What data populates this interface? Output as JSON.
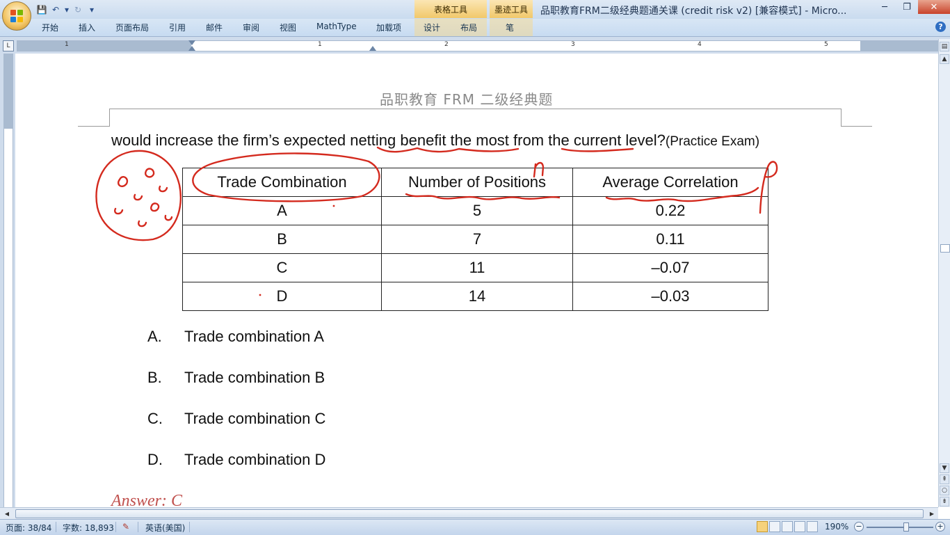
{
  "titlebar": {
    "window_title": "品职教育FRM二级经典题通关课 (credit risk v2) [兼容模式] - Micro...",
    "context_tab_table": "表格工具",
    "context_tab_ink": "墨迹工具",
    "minimize": "─",
    "restore": "❐",
    "close": "✕"
  },
  "qat": {
    "save_icon": "💾",
    "undo_icon": "↶",
    "undo_dropdown": "▾",
    "redo_icon": "↻",
    "customize_icon": "▾"
  },
  "ribbon": {
    "tabs": [
      "开始",
      "插入",
      "页面布局",
      "引用",
      "邮件",
      "审阅",
      "视图",
      "MathType",
      "加载项",
      "设计",
      "布局",
      "笔"
    ],
    "help": "?"
  },
  "ruler": {
    "corner": "L",
    "numbers": [
      "1",
      "1",
      "2",
      "3",
      "4",
      "5"
    ]
  },
  "document": {
    "header": "品职教育    FRM 二级经典题",
    "question": "would increase the firm’s expected netting benefit the most from the current level?",
    "question_source": "(Practice Exam)",
    "table": {
      "headers": [
        "Trade Combination",
        "Number of Positions",
        "Average Correlation"
      ],
      "rows": [
        [
          "A",
          "5",
          "0.22"
        ],
        [
          "B",
          "7",
          "0.11"
        ],
        [
          "C",
          "11",
          "–0.07"
        ],
        [
          "D",
          "14",
          "–0.03"
        ]
      ]
    },
    "options": [
      {
        "letter": "A.",
        "text": "Trade combination A"
      },
      {
        "letter": "B.",
        "text": "Trade combination B"
      },
      {
        "letter": "C.",
        "text": "Trade combination C"
      },
      {
        "letter": "D.",
        "text": "Trade combination D"
      }
    ],
    "answer": "Answer: C"
  },
  "statusbar": {
    "page": "页面: 38/84",
    "words": "字数: 18,893",
    "language": "英语(美国)",
    "zoom": "190%",
    "zoom_out": "−",
    "zoom_in": "+"
  },
  "colors": {
    "ink": "#d42a1e",
    "title_bg": "#c9dbef",
    "answer": "#c0504d"
  }
}
